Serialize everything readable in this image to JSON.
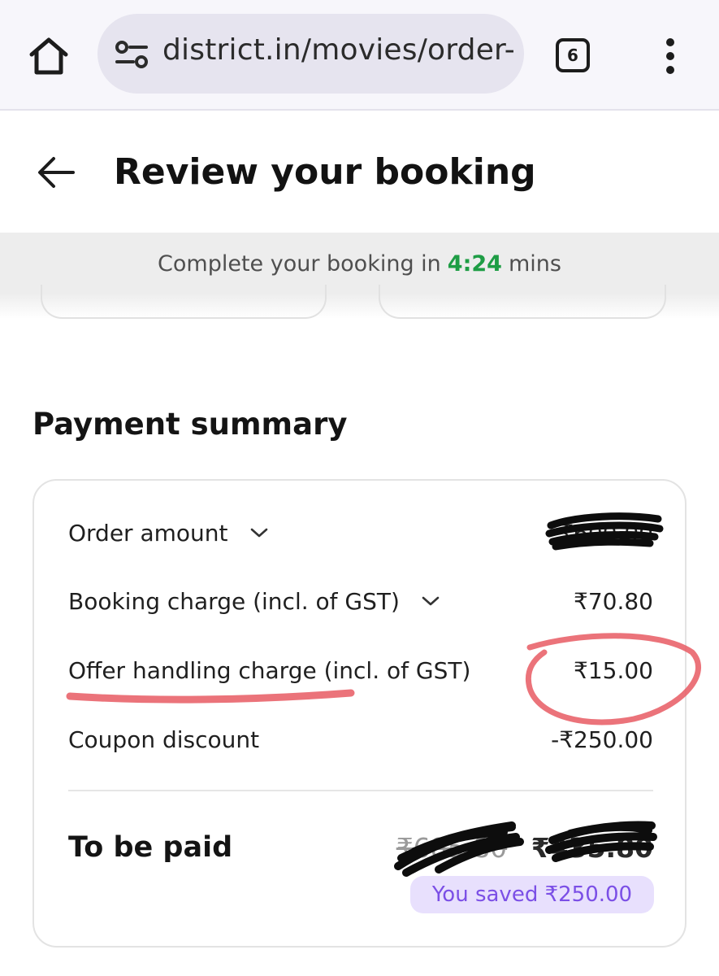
{
  "browser": {
    "url": "district.in/movies/order-",
    "tab_count": "6",
    "icons": {
      "home": "home-icon",
      "site_info": "tune-icon",
      "menu": "more-vert-icon"
    }
  },
  "header": {
    "title": "Review your booking",
    "back_icon": "arrow-left-icon"
  },
  "timer": {
    "prefix": "Complete your booking in",
    "time": "4:24",
    "suffix": "mins",
    "time_color": "#1e9d45"
  },
  "payment_summary": {
    "title": "Payment summary",
    "rows": [
      {
        "label": "Order amount",
        "amount": "₹600.00",
        "expandable": true
      },
      {
        "label": "Booking charge (incl. of GST)",
        "amount": "₹70.80",
        "expandable": true
      },
      {
        "label": "Offer handling charge (incl. of GST)",
        "amount": "₹15.00",
        "expandable": false
      },
      {
        "label": "Coupon discount",
        "amount": "-₹250.00",
        "expandable": false
      }
    ],
    "total": {
      "label": "To be paid",
      "original_amount": "₹685.80",
      "amount": "₹435.80"
    },
    "saved_badge": "You saved ₹250.00",
    "badge_color": "#7b4fe6"
  },
  "annotations": {
    "marker_color": "#e85a63"
  }
}
